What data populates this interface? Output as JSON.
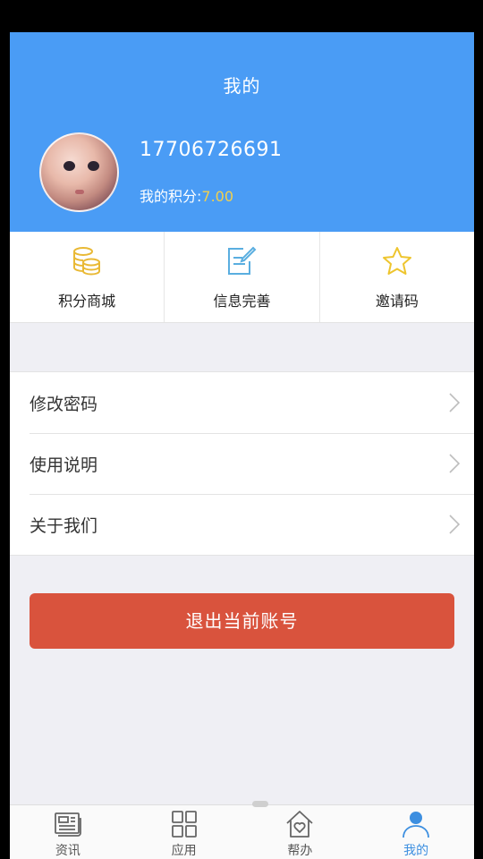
{
  "header": {
    "title": "我的",
    "phone": "17706726691",
    "points_label": "我的积分:",
    "points_value": "7.00"
  },
  "quick_actions": [
    {
      "label": "积分商城",
      "icon": "coins-icon"
    },
    {
      "label": "信息完善",
      "icon": "edit-document-icon"
    },
    {
      "label": "邀请码",
      "icon": "star-icon"
    }
  ],
  "menu": {
    "items": [
      {
        "label": "修改密码"
      },
      {
        "label": "使用说明"
      },
      {
        "label": "关于我们"
      }
    ]
  },
  "logout_label": "退出当前账号",
  "tabbar": {
    "tabs": [
      {
        "label": "资讯",
        "icon": "news-icon",
        "active": false
      },
      {
        "label": "应用",
        "icon": "grid-apps-icon",
        "active": false
      },
      {
        "label": "帮办",
        "icon": "home-heart-icon",
        "active": false
      },
      {
        "label": "我的",
        "icon": "user-icon",
        "active": true
      }
    ]
  },
  "colors": {
    "header_bg": "#4a9cf5",
    "points_value": "#f2d04d",
    "logout_bg": "#d9533d",
    "tab_active": "#3d8fe0"
  }
}
